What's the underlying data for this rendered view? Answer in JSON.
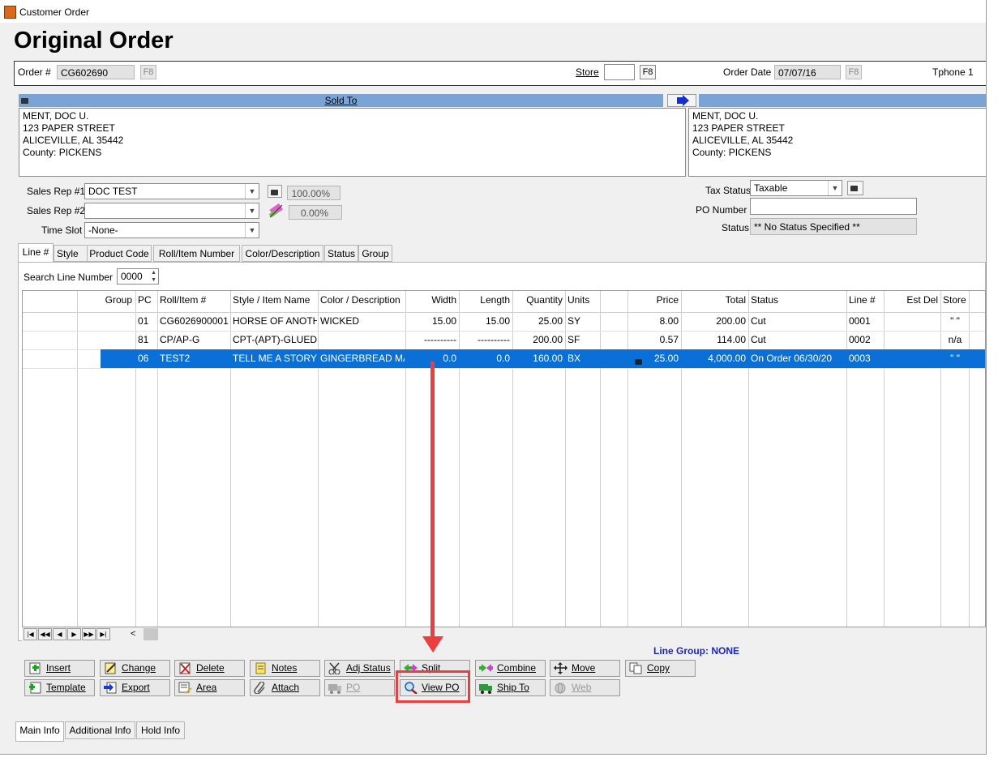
{
  "window": {
    "title": "Customer Order"
  },
  "page_title": "Original Order",
  "header": {
    "order_label": "Order #",
    "order_value": "CG602690",
    "f8": "F8",
    "store_label": "Store",
    "store_value": "",
    "order_date_label": "Order Date",
    "order_date_value": "07/07/16",
    "tphone_label": "Tphone 1"
  },
  "sold_to": {
    "title": "Sold To",
    "lines": [
      "MENT, DOC U.",
      "123 PAPER STREET",
      "ALICEVILLE, AL  35442",
      "County: PICKENS"
    ]
  },
  "ship_to": {
    "lines": [
      "MENT, DOC U.",
      "123 PAPER STREET",
      "ALICEVILLE, AL  35442",
      "County: PICKENS"
    ]
  },
  "sales": {
    "rep1_label": "Sales Rep #1",
    "rep1_value": "DOC TEST",
    "rep1_pct": "100.00%",
    "rep2_label": "Sales Rep #2",
    "rep2_value": "",
    "rep2_pct": "0.00%",
    "timeslot_label": "Time Slot",
    "timeslot_value": "-None-"
  },
  "tax": {
    "status_label": "Tax Status",
    "status_value": "Taxable",
    "po_label": "PO Number",
    "po_value": "",
    "order_status_label": "Status",
    "order_status_value": "** No Status Specified **"
  },
  "tabs": [
    "Line #",
    "Style",
    "Product Code",
    "Roll/Item Number",
    "Color/Description",
    "Status",
    "Group"
  ],
  "search": {
    "label": "Search Line Number",
    "value": "0000"
  },
  "grid": {
    "columns": [
      "Group",
      "PC",
      "Roll/Item #",
      "Style / Item Name",
      "Color / Description",
      "Width",
      "Length",
      "Quantity",
      "Units",
      "Price",
      "Total",
      "Status",
      "Line #",
      "Est Del",
      "Store"
    ],
    "rows": [
      {
        "group": "",
        "pc": "01",
        "roll": "CG6026900001",
        "style": "HORSE OF ANOTHER",
        "color": "WICKED",
        "width": "15.00",
        "length": "15.00",
        "qty": "25.00",
        "units": "SY",
        "price": "8.00",
        "total": "200.00",
        "status": "Cut",
        "line": "0001",
        "estdel": "",
        "store": "\" \""
      },
      {
        "group": "",
        "pc": "81",
        "roll": "CP/AP-G",
        "style": "CPT-(APT)-GLUEDOWN",
        "color": "",
        "width": "----------",
        "length": "----------",
        "qty": "200.00",
        "units": "SF",
        "price": "0.57",
        "total": "114.00",
        "status": "Cut",
        "line": "0002",
        "estdel": "",
        "store": "n/a"
      },
      {
        "group": "",
        "pc": "06",
        "roll": "TEST2",
        "style": "TELL ME A STORY",
        "color": "GINGERBREAD MAN",
        "width": "0.0",
        "length": "0.0",
        "qty": "160.00",
        "units": "BX",
        "price": "25.00",
        "total": "4,000.00",
        "status": "On Order 06/30/20",
        "line": "0003",
        "estdel": "",
        "store": "\" \""
      }
    ]
  },
  "line_group": "Line Group: NONE",
  "buttons": {
    "insert": "Insert",
    "change": "Change",
    "delete": "Delete",
    "notes": "Notes",
    "adj_status": "Adj Status",
    "split": "Split",
    "combine": "Combine",
    "move": "Move",
    "copy": "Copy",
    "template": "Template",
    "export": "Export",
    "area": "Area",
    "attach": "Attach",
    "po": "PO",
    "view_po": "View PO",
    "ship_to": "Ship To",
    "web": "Web"
  },
  "bottom_tabs": [
    "Main Info",
    "Additional Info",
    "Hold Info"
  ],
  "colors": {
    "selection": "#0a70d8",
    "bar": "#7aa3d6",
    "annotation": "#ee3d3d",
    "line_group": "#1a24c8"
  }
}
